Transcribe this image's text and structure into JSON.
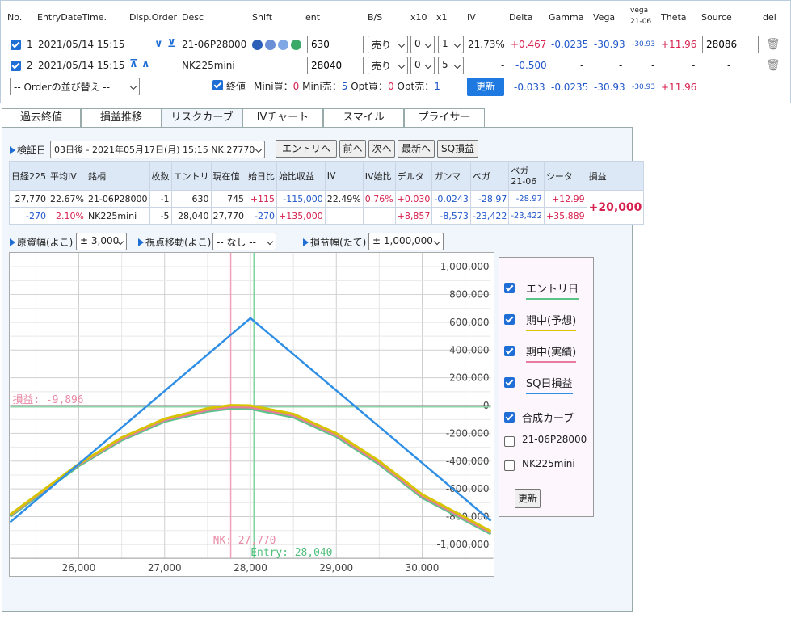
{
  "header": {
    "no": "No.",
    "entry_date": "EntryDateTime.",
    "disp_order": "Disp.Order",
    "desc": "Desc",
    "shift": "Shift",
    "ent": "ent",
    "bs": "B/S",
    "x10": "x10",
    "x1": "x1",
    "iv": "IV",
    "delta": "Delta",
    "gamma": "Gamma",
    "vega": "Vega",
    "vega_2106_top": "vega",
    "vega_2106_bottom": "21-06",
    "theta": "Theta",
    "source": "Source",
    "del": "del"
  },
  "rows": [
    {
      "no": "1",
      "date": "2021/05/14 15:15",
      "desc": "21-06P28000",
      "ent": "630",
      "bs": "売り",
      "x10": "0",
      "x1": "1",
      "iv": "21.73%",
      "delta": "+0.467",
      "gamma": "-0.0235",
      "vega": "-30.93",
      "vega2106": "-30.93",
      "theta": "+11.96",
      "source": "28086"
    },
    {
      "no": "2",
      "date": "2021/05/14 15:15",
      "desc": "NK225mini",
      "ent": "28040",
      "bs": "売り",
      "x10": "0",
      "x1": "5",
      "iv": "-",
      "delta": "-0.500",
      "gamma": "-",
      "vega": "-",
      "vega2106": "-",
      "theta": "-",
      "source": "-"
    }
  ],
  "summary": {
    "sort_select": "-- Orderの並び替え --",
    "close_label": "終値",
    "mini_buy_label": "Mini買：",
    "mini_buy": "0",
    "mini_sell_label": "Mini売：",
    "mini_sell": "5",
    "opt_buy_label": "Opt買：",
    "opt_buy": "0",
    "opt_sell_label": "Opt売：",
    "opt_sell": "1",
    "update_button": "更新",
    "delta": "-0.033",
    "gamma": "-0.0235",
    "vega": "-30.93",
    "vega2106": "-30.93",
    "theta": "+11.96"
  },
  "tabs": [
    "過去終値",
    "損益推移",
    "リスクカーブ",
    "IVチャート",
    "スマイル",
    "プライサー"
  ],
  "active_tab": 2,
  "controls": {
    "verify_label": "検証日",
    "verify_select": "03日後 - 2021年05月17日(月) 15:15 NK:27770",
    "entry_btn": "エントリへ",
    "prev_btn": "前へ",
    "next_btn": "次へ",
    "latest_btn": "最新へ",
    "sq_btn": "SQ損益"
  },
  "table": {
    "headers": [
      "日経225",
      "平均IV",
      "銘柄",
      "枚数",
      "エントリ",
      "現在値",
      "始日比",
      "始比収益",
      "IV",
      "IV始比",
      "デルタ",
      "ガンマ",
      "ベガ",
      "ベガ",
      "21-06",
      "シータ",
      "損益"
    ],
    "nk_price": "27,770",
    "nk_change": "-270",
    "avg_iv": "22.67%",
    "avg_iv_change": "2.10%",
    "r1": {
      "name": "21-06P28000",
      "qty": "-1",
      "entry": "630",
      "price": "745",
      "chg": "+115",
      "pnl": "-115,000",
      "iv": "22.49%",
      "ivchg": "0.76%",
      "delta": "+0.030",
      "gamma": "-0.0243",
      "vega": "-28.97",
      "vega2106": "-28.97",
      "theta": "+12.99"
    },
    "r2": {
      "name": "NK225mini",
      "qty": "-5",
      "entry": "28,040",
      "price": "27,770",
      "chg": "-270",
      "pnl": "+135,000",
      "delta": "+8,857",
      "gamma": "-8,573",
      "vega": "-23,422",
      "vega2106": "-23,422",
      "theta": "+35,889"
    },
    "total": "+20,000"
  },
  "range": {
    "underlying_label": "原資幅(よこ)",
    "underlying_val": "± 3,000",
    "view_label": "視点移動(よこ)",
    "view_val": "-- なし --",
    "pl_label": "損益幅(たて)",
    "pl_val": "± 1,000,000"
  },
  "chart_data": {
    "type": "line",
    "xlim": [
      25200,
      30800
    ],
    "ylim": [
      -1100000,
      1100000
    ],
    "x_ticks": [
      "26,000",
      "27,000",
      "28,000",
      "29,000",
      "30,000"
    ],
    "y_ticks": [
      "1,000,000",
      "800,000",
      "600,000",
      "400,000",
      "200,000",
      "0",
      "-200,000",
      "-400,000",
      "-600,000",
      "-800,000",
      "-1,000,000"
    ],
    "nk_label": "NK: 27,770",
    "nk_value": 27770,
    "entry_label": "Entry: 28,040",
    "entry_value": 28040,
    "pl_label": "損益: -9,896",
    "pl_value": -9896,
    "grid": true,
    "series": [
      {
        "name": "SQ日損益",
        "color": "#2f8fe6",
        "x": [
          25200,
          28000,
          30800
        ],
        "y": [
          -840000,
          630000,
          -830000
        ]
      },
      {
        "name": "期中(予想)",
        "color": "#d6c400",
        "x": [
          25200,
          26000,
          26500,
          27000,
          27500,
          27770,
          28000,
          28500,
          29000,
          29500,
          30000,
          30800
        ],
        "y": [
          -785000,
          -420000,
          -230000,
          -95000,
          -20000,
          3000,
          0,
          -60000,
          -200000,
          -400000,
          -640000,
          -905000
        ]
      },
      {
        "name": "期中(実績)",
        "color": "#e87ca0",
        "x": [
          25200,
          26000,
          26500,
          27000,
          27500,
          27770,
          28000,
          28500,
          29000,
          29500,
          30000,
          30800
        ],
        "y": [
          -790000,
          -425000,
          -240000,
          -105000,
          -32000,
          -10000,
          -12000,
          -72000,
          -212000,
          -412000,
          -652000,
          -915000
        ]
      },
      {
        "name": "エントリ日",
        "color": "#5cc389",
        "x": [
          25200,
          26000,
          26500,
          27000,
          27500,
          27770,
          28000,
          28500,
          29000,
          29500,
          30000,
          30800
        ],
        "y": [
          -800000,
          -435000,
          -250000,
          -115000,
          -42000,
          -22000,
          -24000,
          -84000,
          -224000,
          -424000,
          -664000,
          -925000
        ]
      }
    ]
  },
  "legend": {
    "items": [
      {
        "label": "エントリ日",
        "color": "#5cc389",
        "checked": true
      },
      {
        "label": "期中(予想)",
        "color": "#d6c400",
        "checked": true
      },
      {
        "label": "期中(実績)",
        "color": "#e87ca0",
        "checked": true
      },
      {
        "label": "SQ日損益",
        "color": "#2f8fe6",
        "checked": true
      }
    ],
    "composite": "合成カーブ",
    "opt1": "21-06P28000",
    "opt2": "NK225mini",
    "update": "更新"
  }
}
